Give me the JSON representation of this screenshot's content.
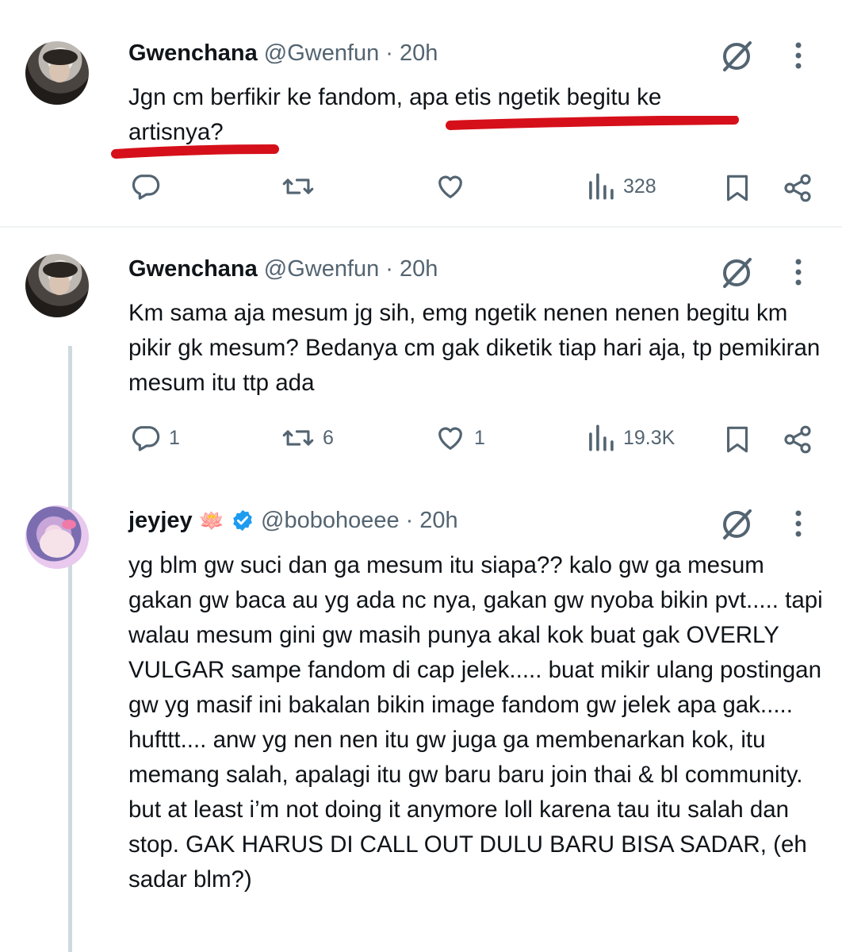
{
  "tweets": [
    {
      "name": "Gwenchana",
      "handle": "@Gwenfun",
      "sep": "·",
      "time": "20h",
      "text": "Jgn cm berfikir ke fandom, apa etis ngetik begitu ke artisnya?",
      "reply_count": "",
      "retweet_count": "",
      "like_count": "",
      "views": "328"
    },
    {
      "name": "Gwenchana",
      "handle": "@Gwenfun",
      "sep": "·",
      "time": "20h",
      "text": "Km sama aja mesum jg sih, emg ngetik nenen nenen begitu km pikir gk mesum? Bedanya cm gak diketik tiap hari aja, tp pemikiran mesum itu ttp ada",
      "reply_count": "1",
      "retweet_count": "6",
      "like_count": "1",
      "views": "19.3K"
    },
    {
      "name": "jeyjey",
      "name_emoji": "🪷",
      "verified": true,
      "handle": "@bobohoeee",
      "sep": "·",
      "time": "20h",
      "text": "yg blm gw suci dan ga mesum itu siapa?? kalo gw ga mesum gakan gw baca au yg ada nc nya, gakan gw nyoba bikin pvt..... tapi walau mesum gini gw masih punya akal kok buat gak OVERLY VULGAR sampe fandom di cap jelek..... buat mikir ulang postingan gw yg masif ini bakalan bikin image fandom gw jelek apa gak..... hufttt.... anw yg nen nen itu gw juga ga membenarkan kok, itu memang salah, apalagi itu gw baru baru join thai & bl community. but at least i’m not doing it anymore loll karena tau itu salah dan stop. GAK HARUS DI CALL OUT DULU BARU BISA SADAR, (eh sadar blm?)"
    }
  ],
  "colors": {
    "text": "#0f1419",
    "secondary": "#536471",
    "verified": "#1d9bf0",
    "annotation": "#d5101a",
    "thread_line": "#cfd9de"
  },
  "icons": [
    "grok-icon",
    "more-icon",
    "reply-icon",
    "retweet-icon",
    "like-icon",
    "views-icon",
    "bookmark-icon",
    "share-icon",
    "verified-badge-icon",
    "lotus-emoji"
  ]
}
